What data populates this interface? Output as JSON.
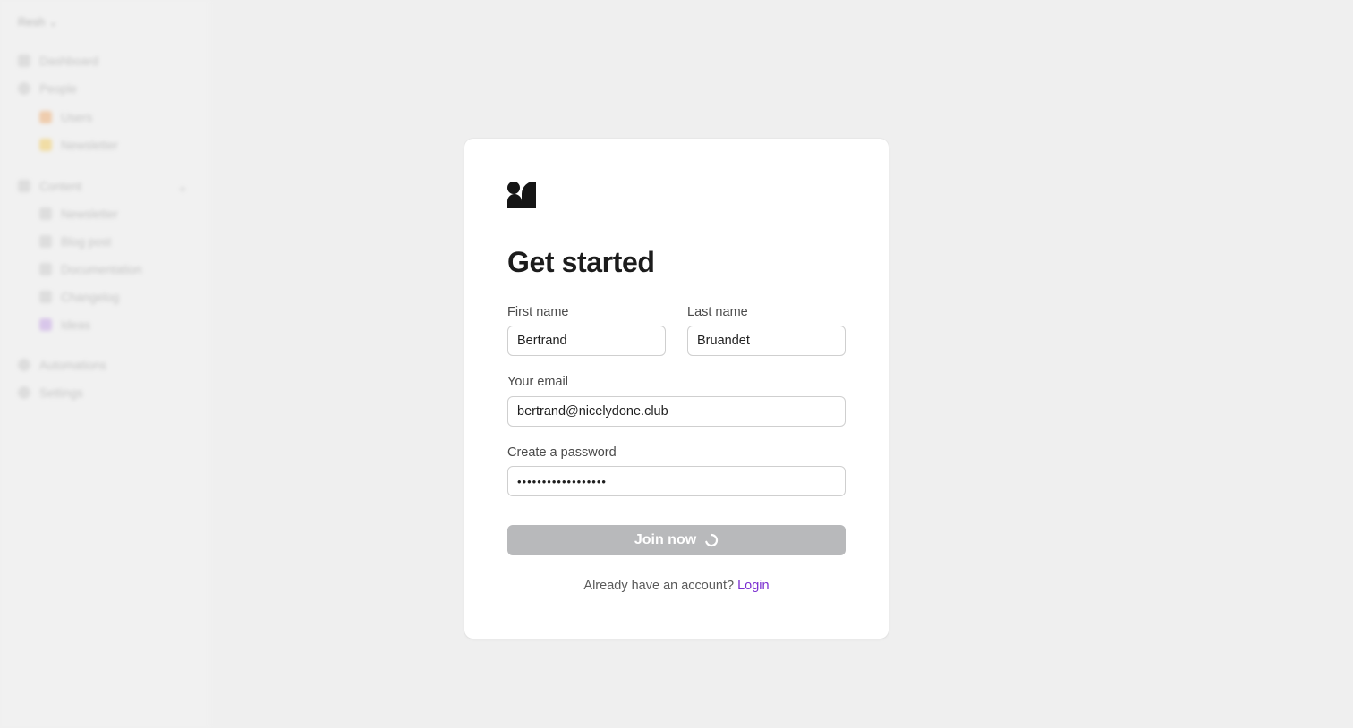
{
  "sidebar": {
    "workspace": "Resh",
    "items": [
      {
        "label": "Dashboard",
        "icon": "chart-icon"
      },
      {
        "label": "People",
        "icon": "person-icon"
      },
      {
        "label": "Users",
        "icon": "users-emoji-icon"
      },
      {
        "label": "Newsletter",
        "icon": "hand-emoji-icon"
      },
      {
        "label": "Content",
        "icon": "chart-bars-icon"
      },
      {
        "label": "Newsletter",
        "icon": "newspaper-icon"
      },
      {
        "label": "Blog post",
        "icon": "pen-icon"
      },
      {
        "label": "Documentation",
        "icon": "document-icon"
      },
      {
        "label": "Changelog",
        "icon": "calendar-icon"
      },
      {
        "label": "Ideas",
        "icon": "bulb-icon"
      },
      {
        "label": "Automations",
        "icon": "automation-icon"
      },
      {
        "label": "Settings",
        "icon": "gear-icon"
      }
    ],
    "add_label": "+"
  },
  "form": {
    "title": "Get started",
    "first_name": {
      "label": "First name",
      "value": "Bertrand"
    },
    "last_name": {
      "label": "Last name",
      "value": "Bruandet"
    },
    "email": {
      "label": "Your email",
      "value": "bertrand@nicelydone.club"
    },
    "password": {
      "label": "Create a password",
      "value": "••••••••••••••••••"
    },
    "submit_label": "Join now",
    "footer_text": "Already have an account?",
    "login_label": "Login"
  },
  "colors": {
    "background": "#efefef",
    "card": "#ffffff",
    "button_disabled": "#b8b9bb",
    "link": "#7b2fd0"
  }
}
